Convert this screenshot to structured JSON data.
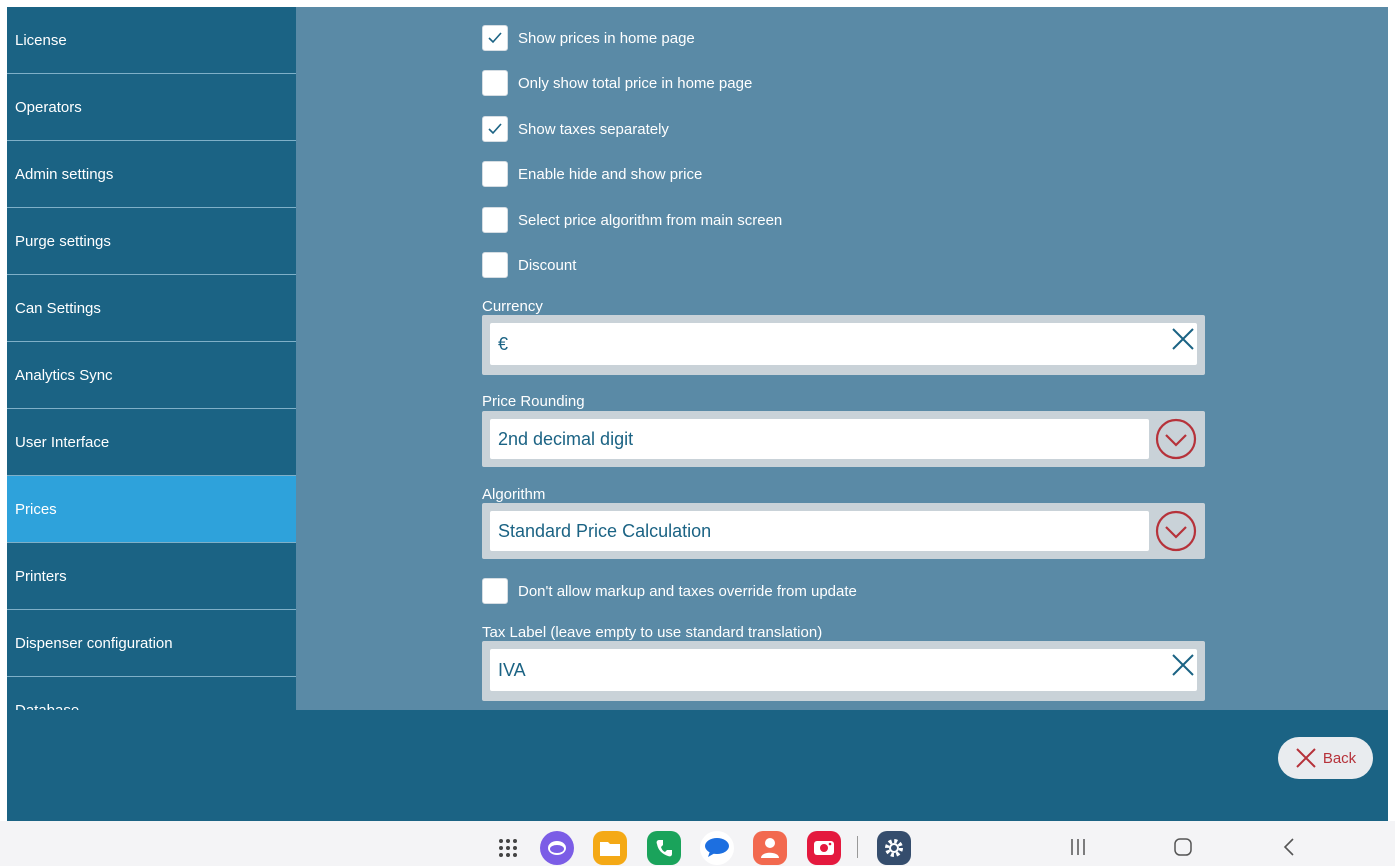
{
  "sidebar": {
    "items": [
      {
        "label": "License",
        "active": false
      },
      {
        "label": "Operators",
        "active": false
      },
      {
        "label": "Admin settings",
        "active": false
      },
      {
        "label": "Purge settings",
        "active": false
      },
      {
        "label": "Can Settings",
        "active": false
      },
      {
        "label": "Analytics Sync",
        "active": false
      },
      {
        "label": "User Interface",
        "active": false
      },
      {
        "label": "Prices",
        "active": true
      },
      {
        "label": "Printers",
        "active": false
      },
      {
        "label": "Dispenser configuration",
        "active": false
      },
      {
        "label": "Database",
        "active": false
      }
    ]
  },
  "prices": {
    "checkboxes": [
      {
        "label": "Show prices in home page",
        "checked": true
      },
      {
        "label": "Only show total price in home page",
        "checked": false
      },
      {
        "label": "Show taxes separately",
        "checked": true
      },
      {
        "label": "Enable hide and show price",
        "checked": false
      },
      {
        "label": "Select price algorithm from main screen",
        "checked": false
      },
      {
        "label": "Discount",
        "checked": false
      }
    ],
    "currency": {
      "label": "Currency",
      "value": "€"
    },
    "price_rounding": {
      "label": "Price Rounding",
      "value": "2nd decimal digit"
    },
    "algorithm": {
      "label": "Algorithm",
      "value": "Standard Price Calculation"
    },
    "override_checkbox": {
      "label": "Don't allow markup and taxes override from update",
      "checked": false
    },
    "tax_label": {
      "label": "Tax Label (leave empty to use standard translation)",
      "value": "IVA"
    }
  },
  "footer": {
    "back_label": "Back"
  },
  "colors": {
    "sidebar_bg": "#1b6384",
    "sidebar_active": "#2ea2db",
    "panel_bg": "#5a8aa6",
    "accent_red": "#b6323a",
    "text_blue": "#1b6384"
  },
  "navbar": {
    "apps": [
      "apps-grid-icon",
      "internet-icon",
      "files-icon",
      "phone-icon",
      "messages-icon",
      "contacts-icon",
      "camera-icon",
      "settings-icon"
    ],
    "system": [
      "recents-icon",
      "home-icon",
      "back-icon"
    ]
  }
}
